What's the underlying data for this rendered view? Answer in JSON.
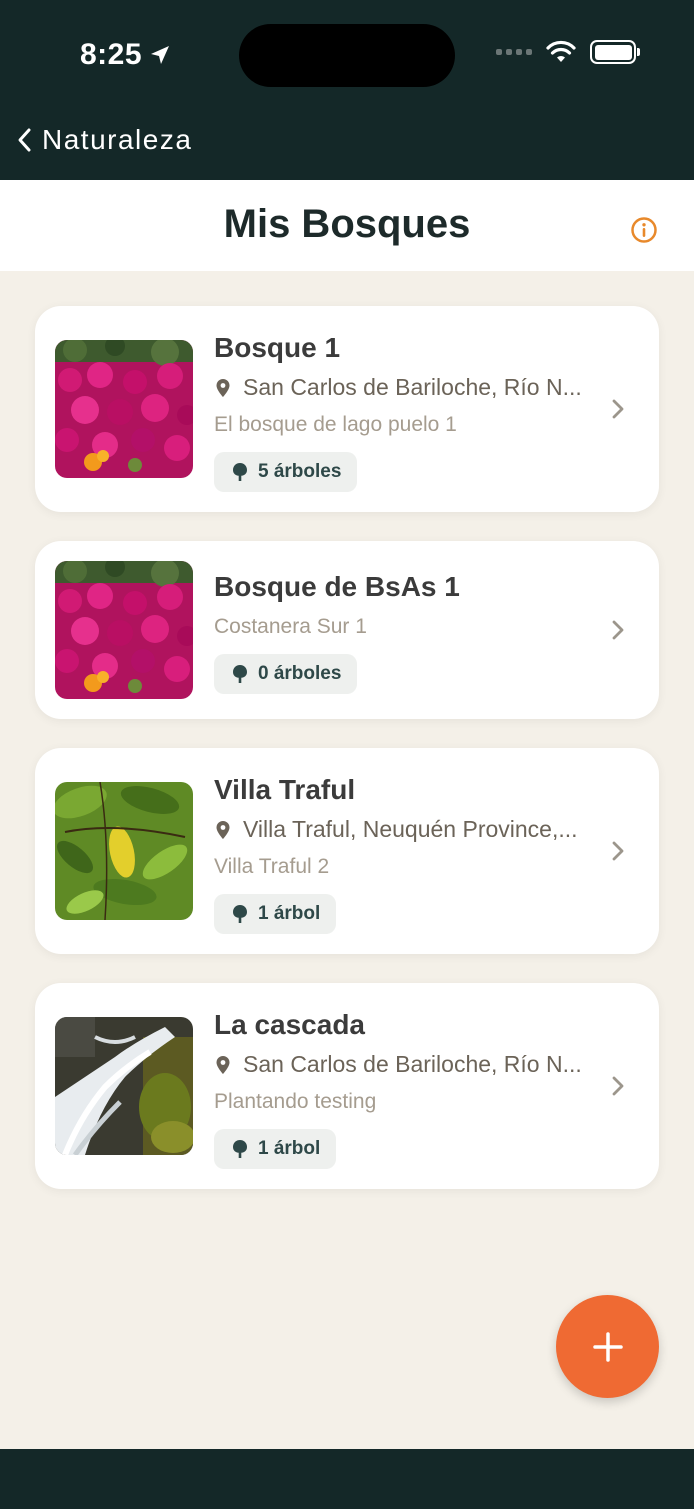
{
  "status_bar": {
    "time": "8:25"
  },
  "nav": {
    "back_label": "Naturaleza"
  },
  "header": {
    "title": "Mis Bosques"
  },
  "forests": [
    {
      "title": "Bosque 1",
      "location": "San Carlos de Bariloche, Río N...",
      "description": "El bosque de lago puelo 1",
      "trees": "5 árboles",
      "image": "pink-flowers"
    },
    {
      "title": "Bosque de BsAs 1",
      "location": "",
      "description": "Costanera Sur 1",
      "trees": "0 árboles",
      "image": "pink-flowers"
    },
    {
      "title": "Villa Traful",
      "location": "Villa Traful, Neuquén Province,...",
      "description": "Villa Traful 2",
      "trees": "1 árbol",
      "image": "green-leaves"
    },
    {
      "title": "La cascada",
      "location": "San Carlos de Bariloche, Río N...",
      "description": "Plantando testing",
      "trees": "1 árbol",
      "image": "waterfall"
    }
  ],
  "colors": {
    "dark": "#142828",
    "background": "#f4f0e8",
    "accent": "#ef6a33",
    "info": "#e8892b"
  },
  "icons": {
    "back": "chevron-left-icon",
    "info": "info-icon",
    "location": "pin-icon",
    "trees": "tree-icon",
    "open": "chevron-right-icon",
    "add": "plus-icon"
  }
}
